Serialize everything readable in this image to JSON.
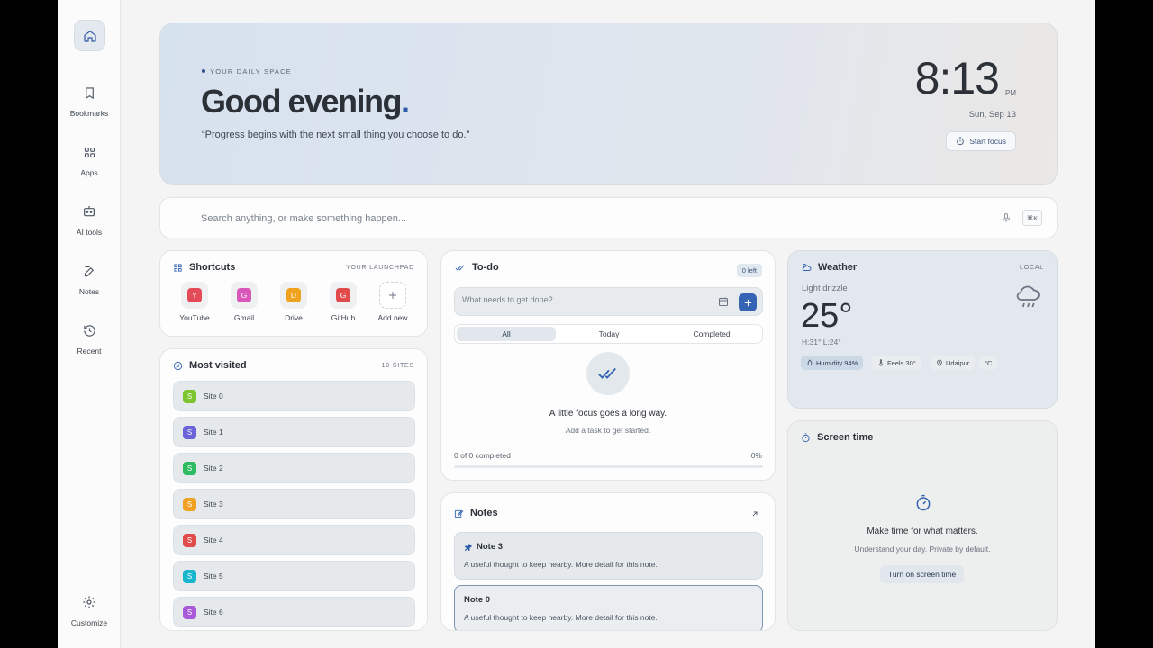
{
  "sidebar": {
    "items": [
      {
        "label": "Bookmarks",
        "icon": "bookmark-icon"
      },
      {
        "label": "Apps",
        "icon": "grid-icon"
      },
      {
        "label": "AI tools",
        "icon": "robot-icon"
      },
      {
        "label": "Notes",
        "icon": "edit-icon"
      },
      {
        "label": "Recent",
        "icon": "history-icon"
      }
    ],
    "customize": "Customize"
  },
  "hero": {
    "eyebrow": "YOUR DAILY SPACE",
    "greeting": "Good evening",
    "greeting_dot": ".",
    "quote": "“Progress begins with the next small thing you choose to do.”",
    "time": "8:13",
    "ampm": "PM",
    "date": "Sun, Sep 13",
    "focus_button": "Start focus"
  },
  "search": {
    "placeholder": "Search anything, or make something happen...",
    "shortcut": "⌘K"
  },
  "shortcuts": {
    "title": "Shortcuts",
    "tag": "YOUR LAUNCHPAD",
    "items": [
      {
        "letter": "Y",
        "name": "YouTube",
        "color": "#e34b58"
      },
      {
        "letter": "G",
        "name": "Gmail",
        "color": "#d957b8"
      },
      {
        "letter": "D",
        "name": "Drive",
        "color": "#efa21d"
      },
      {
        "letter": "G",
        "name": "GitHub",
        "color": "#e14b4b"
      }
    ],
    "add_label": "Add new"
  },
  "most_visited": {
    "title": "Most visited",
    "count": "10 SITES",
    "sites": [
      {
        "letter": "S",
        "name": "Site 0",
        "color": "#7cc52e"
      },
      {
        "letter": "S",
        "name": "Site 1",
        "color": "#6a63d9"
      },
      {
        "letter": "S",
        "name": "Site 2",
        "color": "#2fbb62"
      },
      {
        "letter": "S",
        "name": "Site 3",
        "color": "#f0a121"
      },
      {
        "letter": "S",
        "name": "Site 4",
        "color": "#e14b4b"
      },
      {
        "letter": "S",
        "name": "Site 5",
        "color": "#18b5cf"
      },
      {
        "letter": "S",
        "name": "Site 6",
        "color": "#a85ad8"
      }
    ]
  },
  "todo": {
    "title": "To-do",
    "left_badge": "0 left",
    "placeholder": "What needs to get done?",
    "tabs": [
      "All",
      "Today",
      "Completed"
    ],
    "empty_title": "A little focus goes a long way.",
    "empty_sub": "Add a task to get started.",
    "progress_label": "0 of 0 completed",
    "progress_pct": "0%",
    "progress_value": 0
  },
  "notes": {
    "title": "Notes",
    "items": [
      {
        "title": "Note 3",
        "body": "A useful thought to keep nearby. More detail for this note."
      },
      {
        "title": "Note 0",
        "body": "A useful thought to keep nearby. More detail for this note."
      }
    ]
  },
  "weather": {
    "title": "Weather",
    "tag": "LOCAL",
    "condition": "Light drizzle",
    "temp": "25°",
    "high_low": "H:31° L:24°",
    "chips": {
      "humidity": "Humidity 94%",
      "feels": "Feels 30°",
      "location": "Udaipur",
      "unit": "°C"
    }
  },
  "screen_time": {
    "title": "Screen time",
    "headline": "Make time for what matters.",
    "sub": "Understand your day. Private by default.",
    "button": "Turn on screen time"
  }
}
